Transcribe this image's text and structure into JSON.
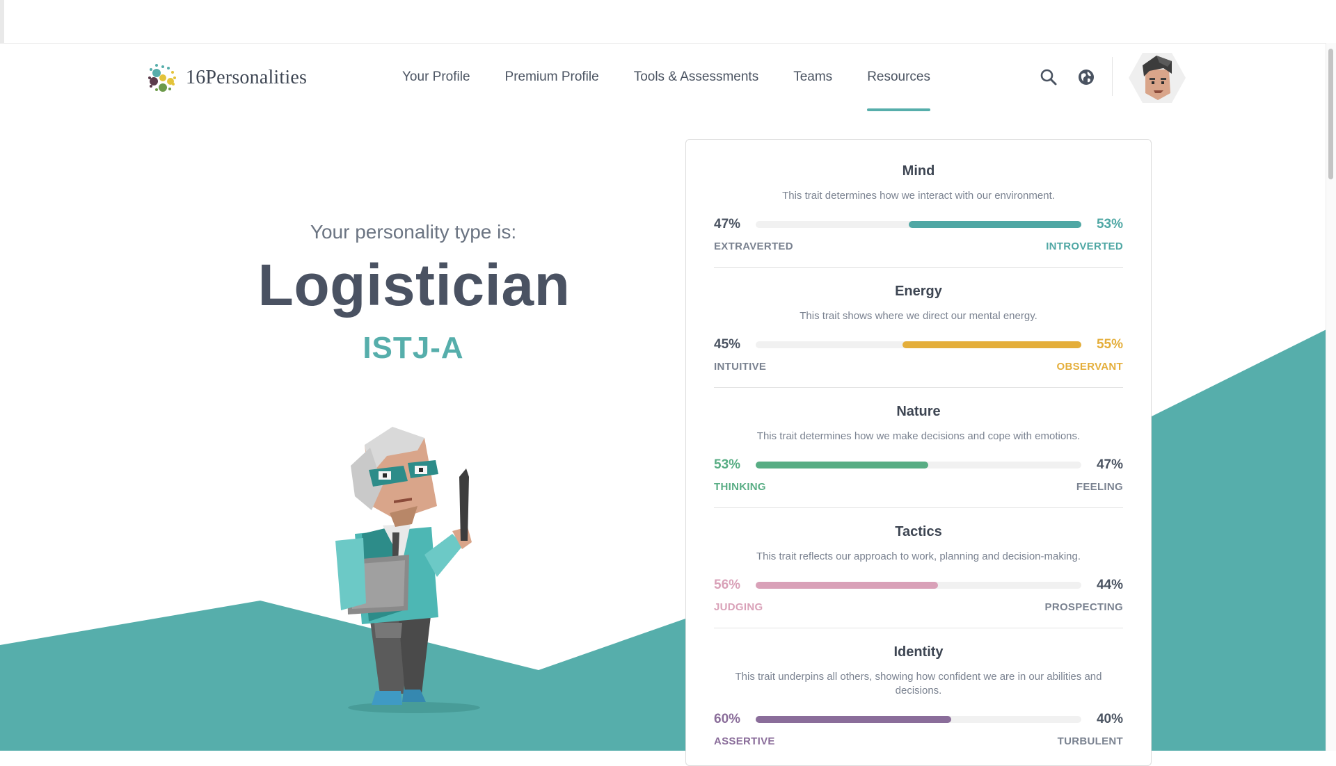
{
  "site": {
    "logo_text": "16Personalities"
  },
  "nav": {
    "items": [
      {
        "label": "Your Profile",
        "active": false
      },
      {
        "label": "Premium Profile",
        "active": false
      },
      {
        "label": "Tools & Assessments",
        "active": false
      },
      {
        "label": "Teams",
        "active": false
      },
      {
        "label": "Resources",
        "active": true
      }
    ],
    "search_icon": "search-icon",
    "language_icon": "globe-icon"
  },
  "hero": {
    "subtitle": "Your personality type is:",
    "title": "Logistician",
    "code": "ISTJ-A"
  },
  "traits": [
    {
      "title": "Mind",
      "description": "This trait determines how we interact with our environment.",
      "left_pct": "47%",
      "right_pct": "53%",
      "left_label": "EXTRAVERTED",
      "right_label": "INTROVERTED",
      "dominant": "right",
      "fill": 0.53,
      "color": "#4fa7a4"
    },
    {
      "title": "Energy",
      "description": "This trait shows where we direct our mental energy.",
      "left_pct": "45%",
      "right_pct": "55%",
      "left_label": "INTUITIVE",
      "right_label": "OBSERVANT",
      "dominant": "right",
      "fill": 0.55,
      "color": "#e4ae3a"
    },
    {
      "title": "Nature",
      "description": "This trait determines how we make decisions and cope with emotions.",
      "left_pct": "53%",
      "right_pct": "47%",
      "left_label": "THINKING",
      "right_label": "FEELING",
      "dominant": "left",
      "fill": 0.53,
      "color": "#58ad84"
    },
    {
      "title": "Tactics",
      "description": "This trait reflects our approach to work, planning and decision-making.",
      "left_pct": "56%",
      "right_pct": "44%",
      "left_label": "JUDGING",
      "right_label": "PROSPECTING",
      "dominant": "left",
      "fill": 0.56,
      "color": "#d9a1b8"
    },
    {
      "title": "Identity",
      "description": "This trait underpins all others, showing how confident we are in our abilities and decisions.",
      "left_pct": "60%",
      "right_pct": "40%",
      "left_label": "ASSERTIVE",
      "right_label": "TURBULENT",
      "dominant": "left",
      "fill": 0.6,
      "color": "#8a6d9a"
    }
  ],
  "colors": {
    "accent": "#56aeab",
    "neutral_text": "#4a5361",
    "muted_text": "#7a8290"
  }
}
